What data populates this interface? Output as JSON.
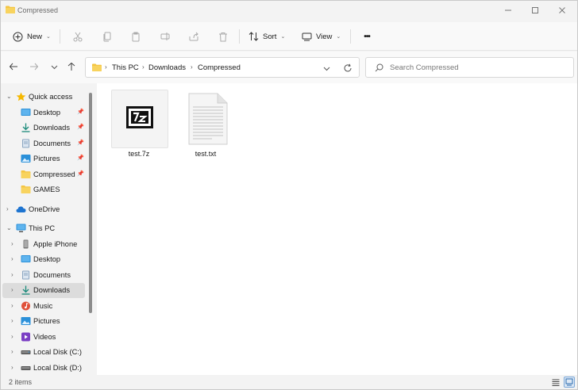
{
  "window": {
    "title": "Compressed"
  },
  "commandbar": {
    "new_label": "New",
    "sort_label": "Sort",
    "view_label": "View",
    "more_label": "•••"
  },
  "address": {
    "crumbs": [
      "This PC",
      "Downloads",
      "Compressed"
    ]
  },
  "search": {
    "placeholder": "Search Compressed"
  },
  "navpane": {
    "quick_access": "Quick access",
    "quick_items": [
      "Desktop",
      "Downloads",
      "Documents",
      "Pictures",
      "Compressed",
      "GAMES"
    ],
    "onedrive": "OneDrive",
    "this_pc": "This PC",
    "pc_items": [
      "Apple iPhone",
      "Desktop",
      "Documents",
      "Downloads",
      "Music",
      "Pictures",
      "Videos",
      "Local Disk (C:)",
      "Local Disk (D:)"
    ]
  },
  "files": [
    {
      "name": "test.7z",
      "icon": "7z-archive-icon"
    },
    {
      "name": "test.txt",
      "icon": "text-file-icon"
    }
  ],
  "status": {
    "count": "2 items"
  },
  "colors": {
    "accent": "#0067c0",
    "folder": "#f4c542",
    "selected": "#dcdcdc"
  }
}
